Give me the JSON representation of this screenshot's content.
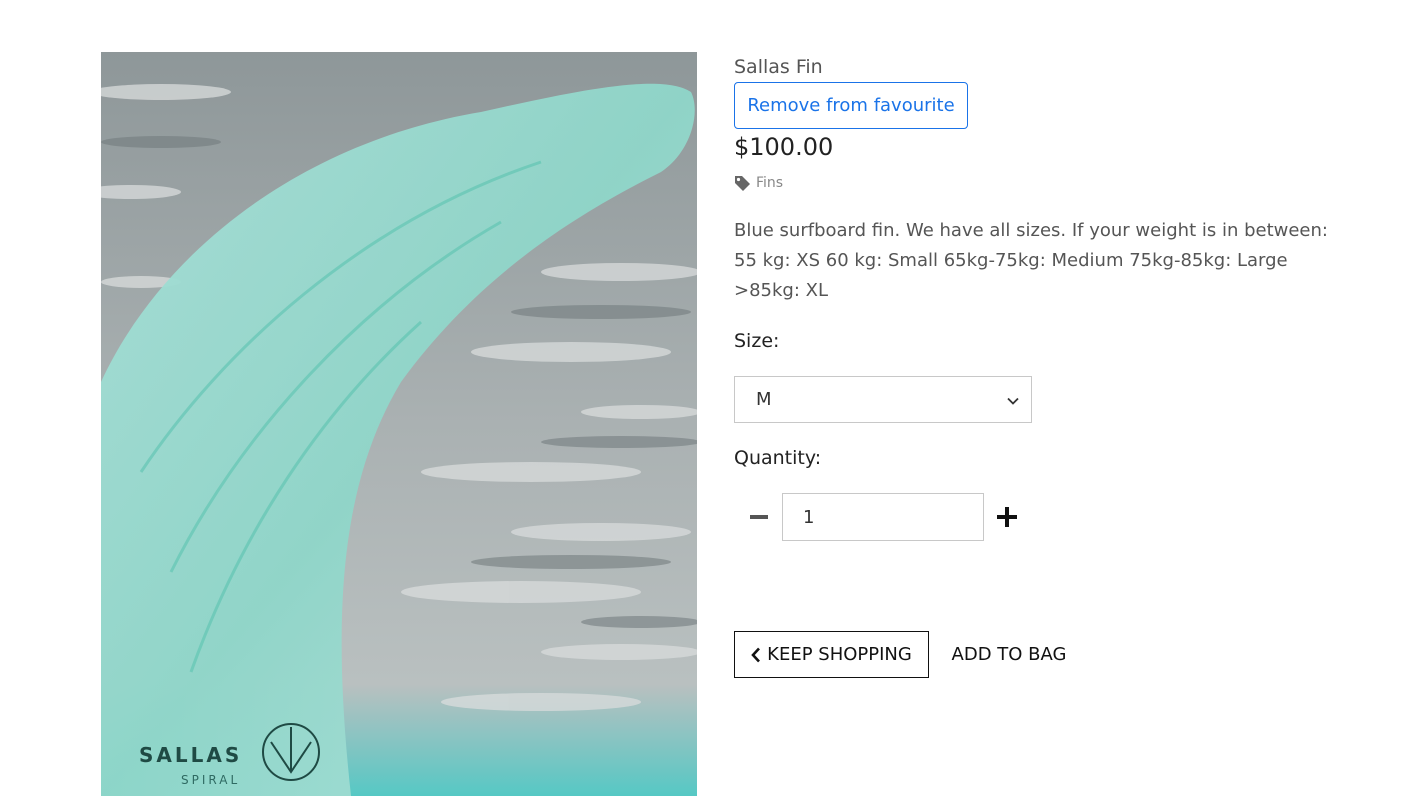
{
  "product": {
    "name": "Sallas Fin",
    "price": "$100.00",
    "category": "Fins",
    "description": "Blue surfboard fin. We have all sizes. If your weight is in between: 55 kg: XS 60 kg: Small 65kg-75kg: Medium 75kg-85kg: Large >85kg: XL",
    "image_logo_text": "SALLAS",
    "image_logo_subtext": "SPIRAL"
  },
  "favourite": {
    "label": "Remove from favourite"
  },
  "size": {
    "label": "Size:",
    "selected": "M"
  },
  "quantity": {
    "label": "Quantity:",
    "value": "1"
  },
  "actions": {
    "keep_shopping": "KEEP SHOPPING",
    "add_to_bag": "ADD TO BAG"
  },
  "icons": {
    "tag": "tag-icon",
    "minus": "minus-icon",
    "plus": "plus-icon",
    "chevron_left": "chevron-left-icon",
    "chevron_down": "chevron-down-icon"
  },
  "colors": {
    "accent": "#1a73e8",
    "fin": "#8fd6c9",
    "water": "#9aa3a5"
  }
}
